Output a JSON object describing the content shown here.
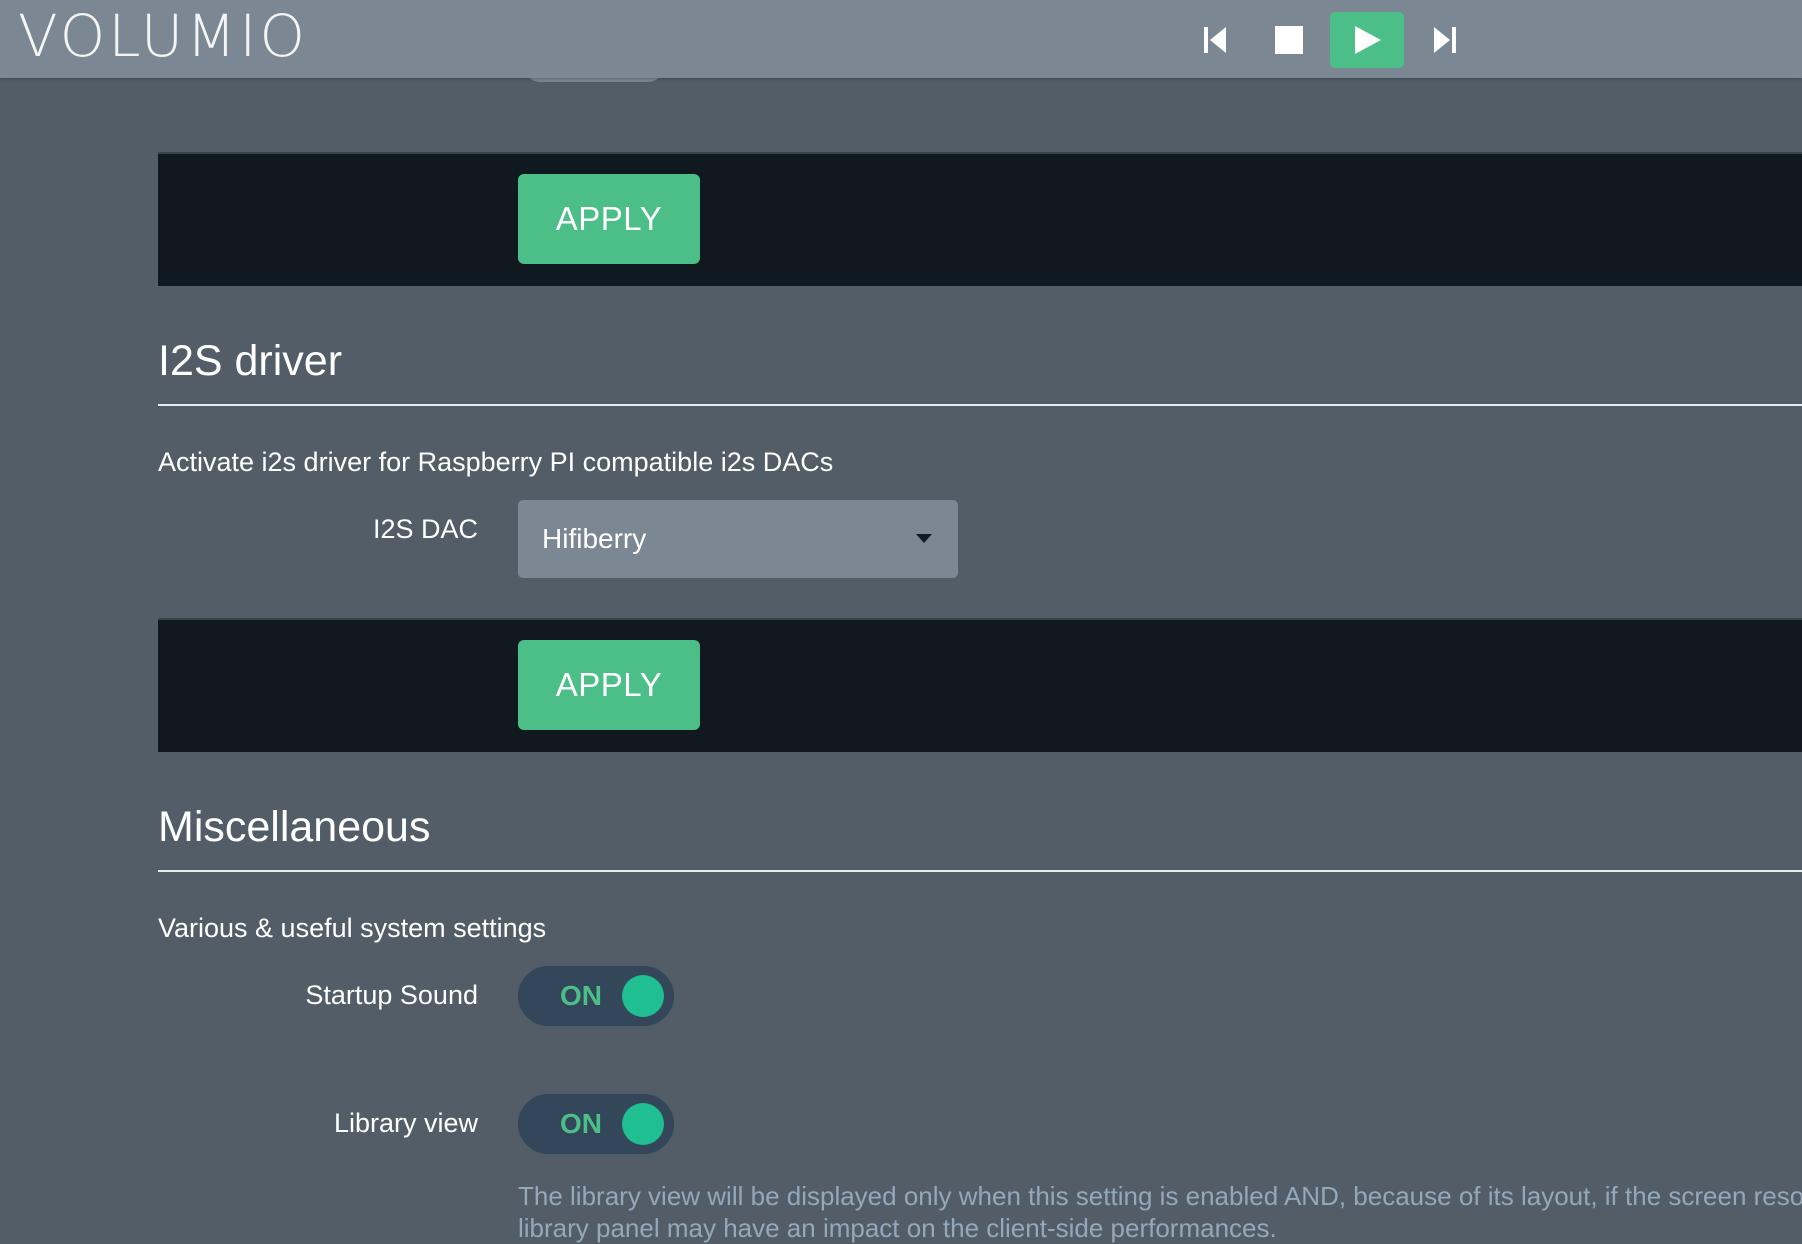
{
  "app": {
    "logo_text": "VOLUMIO"
  },
  "transport": {
    "previous_icon": "skip-previous-icon",
    "stop_icon": "stop-icon",
    "play_icon": "play-icon",
    "next_icon": "skip-next-icon"
  },
  "colors": {
    "accent": "#4cbe87",
    "topbar": "#7b8792",
    "background": "#525d68",
    "apply_bar": "#101820",
    "toggle_track": "#34465a",
    "toggle_knob": "#1fbf92",
    "help_text": "#94a8bc"
  },
  "sections": {
    "previous_section": {
      "apply_label": "APPLY"
    },
    "i2s": {
      "title": "I2S driver",
      "description": "Activate i2s driver for Raspberry PI compatible i2s DACs",
      "dac_label": "I2S DAC",
      "dac_selected": "Hifiberry",
      "apply_label": "APPLY"
    },
    "misc": {
      "title": "Miscellaneous",
      "description": "Various & useful system settings",
      "startup_sound": {
        "label": "Startup Sound",
        "state": "ON"
      },
      "library_view": {
        "label": "Library view",
        "state": "ON",
        "help_line1": "The library view will be displayed only when this setting is enabled AND, because of its layout, if the screen resolut",
        "help_line2": "library panel may have an impact on the client-side performances."
      }
    }
  }
}
